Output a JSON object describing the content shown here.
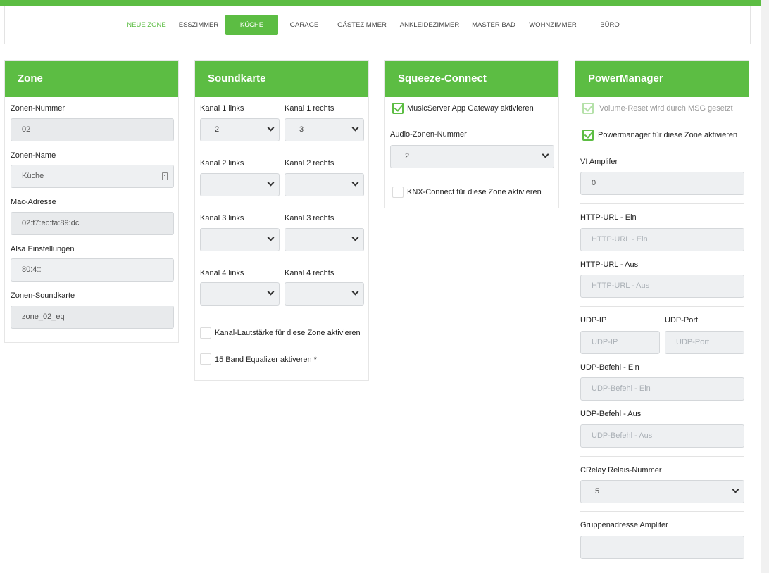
{
  "nav": {
    "tabs": [
      {
        "label": "NEUE ZONE"
      },
      {
        "label": "ESSZIMMER"
      },
      {
        "label": "KÜCHE",
        "active": true
      },
      {
        "label": "GARAGE"
      },
      {
        "label": "GÄSTEZIMMER"
      },
      {
        "label": "ANKLEIDEZIMMER"
      },
      {
        "label": "MASTER BAD"
      },
      {
        "label": "WOHNZIMMER"
      },
      {
        "label": "BÜRO"
      }
    ]
  },
  "zone": {
    "title": "Zone",
    "nummer_label": "Zonen-Nummer",
    "nummer": "02",
    "name_label": "Zonen-Name",
    "name": "Küche",
    "mac_label": "Mac-Adresse",
    "mac": "02:f7:ec:fa:89:dc",
    "alsa_label": "Alsa Einstellungen",
    "alsa": "80:4::",
    "soundkarte_label": "Zonen-Soundkarte",
    "soundkarte": "zone_02_eq"
  },
  "soundkarte": {
    "title": "Soundkarte",
    "channels": [
      {
        "left_label": "Kanal 1 links",
        "left": "2",
        "right_label": "Kanal 1 rechts",
        "right": "3"
      },
      {
        "left_label": "Kanal 2 links",
        "left": "",
        "right_label": "Kanal 2 rechts",
        "right": ""
      },
      {
        "left_label": "Kanal 3 links",
        "left": "",
        "right_label": "Kanal 3 rechts",
        "right": ""
      },
      {
        "left_label": "Kanal 4 links",
        "left": "",
        "right_label": "Kanal 4 rechts",
        "right": ""
      }
    ],
    "volume_cb": {
      "label": "Kanal-Lautstärke für diese Zone aktivieren",
      "checked": false
    },
    "eq_cb": {
      "label": "15 Band Equalizer aktiveren *",
      "checked": false
    }
  },
  "squeeze": {
    "title": "Squeeze-Connect",
    "gateway_cb": {
      "label": "MusicServer App Gateway aktivieren",
      "checked": true
    },
    "audio_label": "Audio-Zonen-Nummer",
    "audio": "2",
    "knx_cb": {
      "label": "KNX-Connect für diese Zone aktivieren",
      "checked": false
    }
  },
  "power": {
    "title": "PowerManager",
    "volreset_cb": {
      "label": "Volume-Reset wird durch MSG gesetzt",
      "checked": true,
      "disabled": true
    },
    "pm_cb": {
      "label": "Powermanager für diese Zone aktivieren",
      "checked": true
    },
    "vi_label": "VI Amplifer",
    "vi": "0",
    "http_ein_label": "HTTP-URL - Ein",
    "http_ein_ph": "HTTP-URL - Ein",
    "http_aus_label": "HTTP-URL - Aus",
    "http_aus_ph": "HTTP-URL - Aus",
    "udp_ip_label": "UDP-IP",
    "udp_ip_ph": "UDP-IP",
    "udp_port_label": "UDP-Port",
    "udp_port_ph": "UDP-Port",
    "udp_ein_label": "UDP-Befehl - Ein",
    "udp_ein_ph": "UDP-Befehl - Ein",
    "udp_aus_label": "UDP-Befehl - Aus",
    "udp_aus_ph": "UDP-Befehl - Aus",
    "crelay_label": "CRelay Relais-Nummer",
    "crelay": "5",
    "gruppe_label": "Gruppenadresse Amplifer",
    "gruppe": ""
  },
  "colors": {
    "accent": "#5cbd43"
  }
}
